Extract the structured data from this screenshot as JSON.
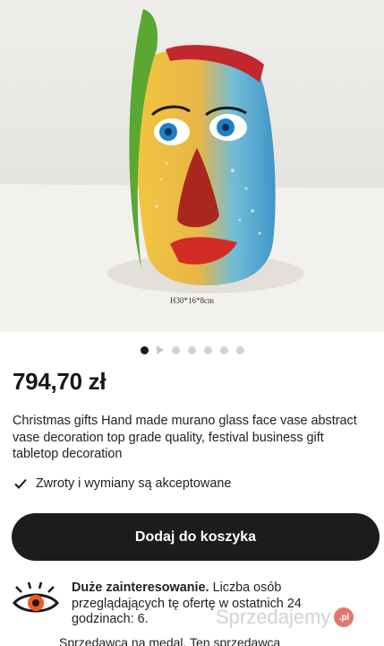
{
  "image": {
    "caption": "H30*16*8cm"
  },
  "carousel": {
    "dot_count": 7,
    "active_index": 0
  },
  "product": {
    "price": "794,70 zł",
    "title": "Christmas gifts Hand made murano glass face vase abstract vase decoration top grade quality, festival business gift tabletop decoration",
    "returns": "Zwroty i wymiany są akceptowane"
  },
  "cart": {
    "button_label": "Dodaj do koszyka"
  },
  "interest": {
    "heading": "Duże zainteresowanie.",
    "body": "Liczba osób przeglądających tę ofertę w ostatnich 24 godzinach: 6.",
    "next_line": "Sprzedawca na medal. Ten sprzedawca"
  },
  "watermark": {
    "text": "Sprzedajemy",
    "badge": ".pl"
  },
  "colors": {
    "button_bg": "#1c1c1c",
    "badge": "#d94a40",
    "eye_orange": "#f05a22"
  }
}
